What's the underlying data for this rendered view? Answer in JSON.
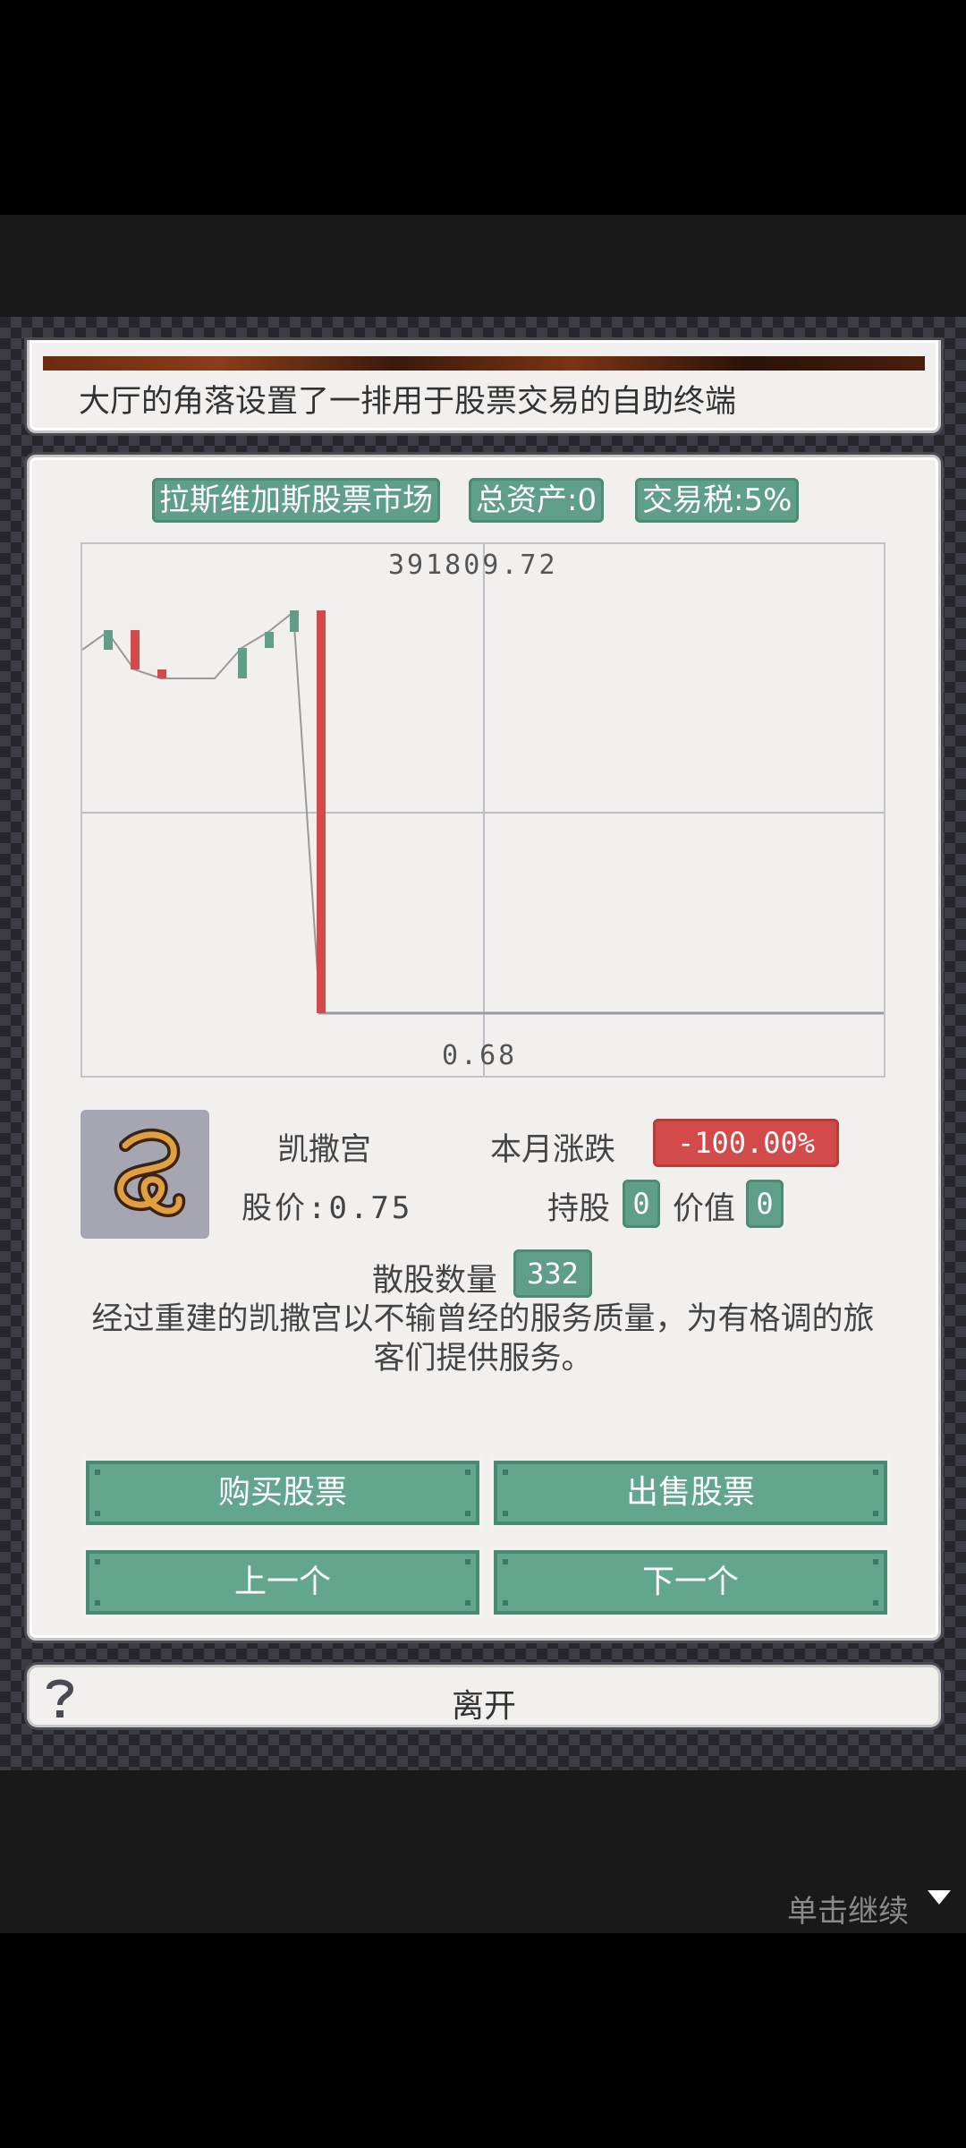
{
  "intro": {
    "text": "大厅的角落设置了一排用于股票交易的自助终端"
  },
  "header": {
    "market": "拉斯维加斯股票市场",
    "total_assets": "总资产:0",
    "tax": "交易税:5%"
  },
  "chart_data": {
    "type": "candlestick",
    "max_label": "391809.72",
    "min_label": "0.68",
    "colors": {
      "up": "#5f9e88",
      "down": "#d24a4a",
      "line": "#999999",
      "grid": "#bdbdc6"
    }
  },
  "stock": {
    "icon": "snake-icon",
    "name": "凯撒宫",
    "change_label": "本月涨跌",
    "change_value": "-100.00%",
    "price_text": "股价:0.75",
    "holdings_label": "持股",
    "holdings_value": "0",
    "value_label": "价值",
    "value_value": "0",
    "float_label": "散股数量",
    "float_value": "332",
    "description": "经过重建的凯撒宫以不输曾经的服务质量，为有格调的旅客们提供服务。"
  },
  "buttons": {
    "buy": "购买股票",
    "sell": "出售股票",
    "prev": "上一个",
    "next": "下一个"
  },
  "leave": {
    "icon": "question-icon",
    "label": "离开"
  },
  "footer": {
    "continue": "单击继续",
    "icon": "triangle-down-icon"
  }
}
